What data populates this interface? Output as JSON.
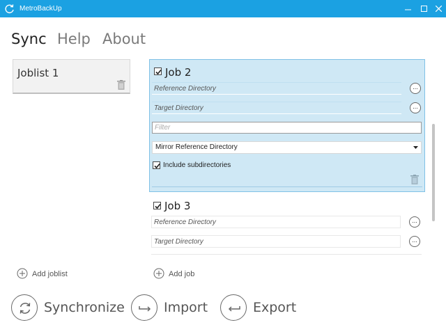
{
  "window": {
    "title": "MetroBackUp"
  },
  "menu": {
    "sync": "Sync",
    "help": "Help",
    "about": "About"
  },
  "joblists": [
    {
      "name": "Joblist 1"
    }
  ],
  "add_joblist": "Add joblist",
  "add_job": "Add job",
  "jobs": [
    {
      "name": "Job 2",
      "checked": true,
      "reference_placeholder": "Reference Directory",
      "target_placeholder": "Target Directory",
      "filter_placeholder": "Filter",
      "mode": "Mirror Reference Directory",
      "include_subdirs": "Include subdirectories"
    },
    {
      "name": "Job 3",
      "checked": true,
      "reference_placeholder": "Reference Directory",
      "target_placeholder": "Target Directory"
    }
  ],
  "browse_label": "...",
  "actions": {
    "synchronize": "Synchronize",
    "import": "Import",
    "export": "Export"
  },
  "colors": {
    "titlebar": "#1ba1e2",
    "selected_job": "#cfe8f5",
    "selected_border": "#7fc1e6"
  }
}
